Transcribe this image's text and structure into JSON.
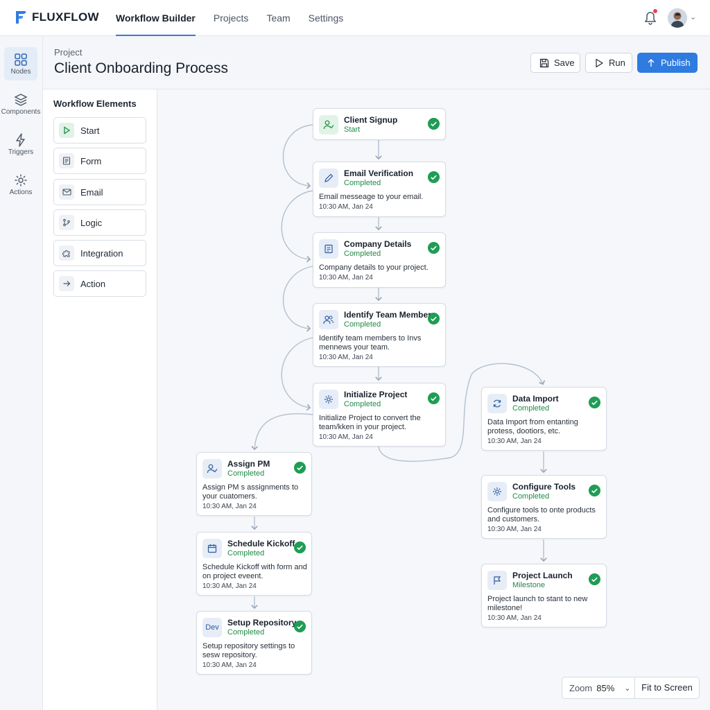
{
  "app": {
    "name": "FLUXFLOW",
    "brand_color": "#2f7be0"
  },
  "nav": [
    {
      "label": "Workflow Builder",
      "active": true
    },
    {
      "label": "Projects",
      "active": false
    },
    {
      "label": "Team",
      "active": false
    },
    {
      "label": "Settings",
      "active": false
    }
  ],
  "notifications": {
    "icon": "bell-icon",
    "has_unread": true
  },
  "rail": [
    {
      "label": "Nodes",
      "icon": "grid-icon",
      "active": true
    },
    {
      "label": "Components",
      "icon": "layers-icon",
      "active": false
    },
    {
      "label": "Triggers",
      "icon": "bolt-icon",
      "active": false
    },
    {
      "label": "Actions",
      "icon": "gear-icon",
      "active": false
    }
  ],
  "header": {
    "label": "Project",
    "title": "Client Onboarding Process",
    "save_label": "Save",
    "run_label": "Run",
    "publish_label": "Publish"
  },
  "panel": {
    "title": "Workflow Elements",
    "items": [
      {
        "label": "Start",
        "icon": "play-icon"
      },
      {
        "label": "Form",
        "icon": "form-icon"
      },
      {
        "label": "Email",
        "icon": "mail-icon"
      },
      {
        "label": "Logic",
        "icon": "branch-icon"
      },
      {
        "label": "Integration",
        "icon": "puzzle-icon"
      },
      {
        "label": "Action",
        "icon": "arrow-right-icon"
      }
    ]
  },
  "nodes": [
    {
      "title": "Client Signup",
      "status": "Start",
      "icon": "user-check-icon",
      "desc": "",
      "time": ""
    },
    {
      "title": "Email Verification",
      "status": "Completed",
      "icon": "pencil-icon",
      "desc": "Email messeage to your email.",
      "time": "10:30 AM, Jan 24"
    },
    {
      "title": "Company Details",
      "status": "Completed",
      "icon": "document-icon",
      "desc": "Company details to your project.",
      "time": "10:30 AM, Jan 24"
    },
    {
      "title": "Identify Team Members",
      "status": "Completed",
      "icon": "users-icon",
      "desc": "Identify team members to Invs mennews your team.",
      "time": "10:30 AM, Jan 24"
    },
    {
      "title": "Initialize Project",
      "status": "Completed",
      "icon": "gear-icon",
      "desc": "Initialize Project to convert the team/kken in your project.",
      "time": "10:30 AM, Jan 24"
    },
    {
      "title": "Assign PM",
      "status": "Completed",
      "icon": "user-check-icon",
      "desc": "Assign PM s assignments to your cuatomers.",
      "time": "10:30 AM, Jan 24"
    },
    {
      "title": "Schedule Kickoff",
      "status": "Completed",
      "icon": "calendar-icon",
      "desc": "Schedule Kickoff with form and on project eveent.",
      "time": "10:30 AM, Jan 24"
    },
    {
      "title": "Setup Repository",
      "status": "Completed",
      "icon": "dev-icon",
      "icon_text": "Dev",
      "desc": "Setup repository settings to sesw repository.",
      "time": "10:30 AM, Jan 24"
    },
    {
      "title": "Data Import",
      "status": "Completed",
      "icon": "refresh-icon",
      "desc": "Data Import from entanting protess, dootiors, etc.",
      "time": "10:30 AM, Jan 24"
    },
    {
      "title": "Configure Tools",
      "status": "Completed",
      "icon": "gear-icon",
      "desc": "Configure tools to onte products and customers.",
      "time": "10:30 AM, Jan 24"
    },
    {
      "title": "Project Launch",
      "status": "Milestone",
      "icon": "flag-icon",
      "desc": "Project launch to stant to new milestone!",
      "time": "10:30 AM, Jan 24"
    }
  ],
  "zoom": {
    "label": "Zoom",
    "value": "85%"
  },
  "fit_label": "Fit to Screen"
}
